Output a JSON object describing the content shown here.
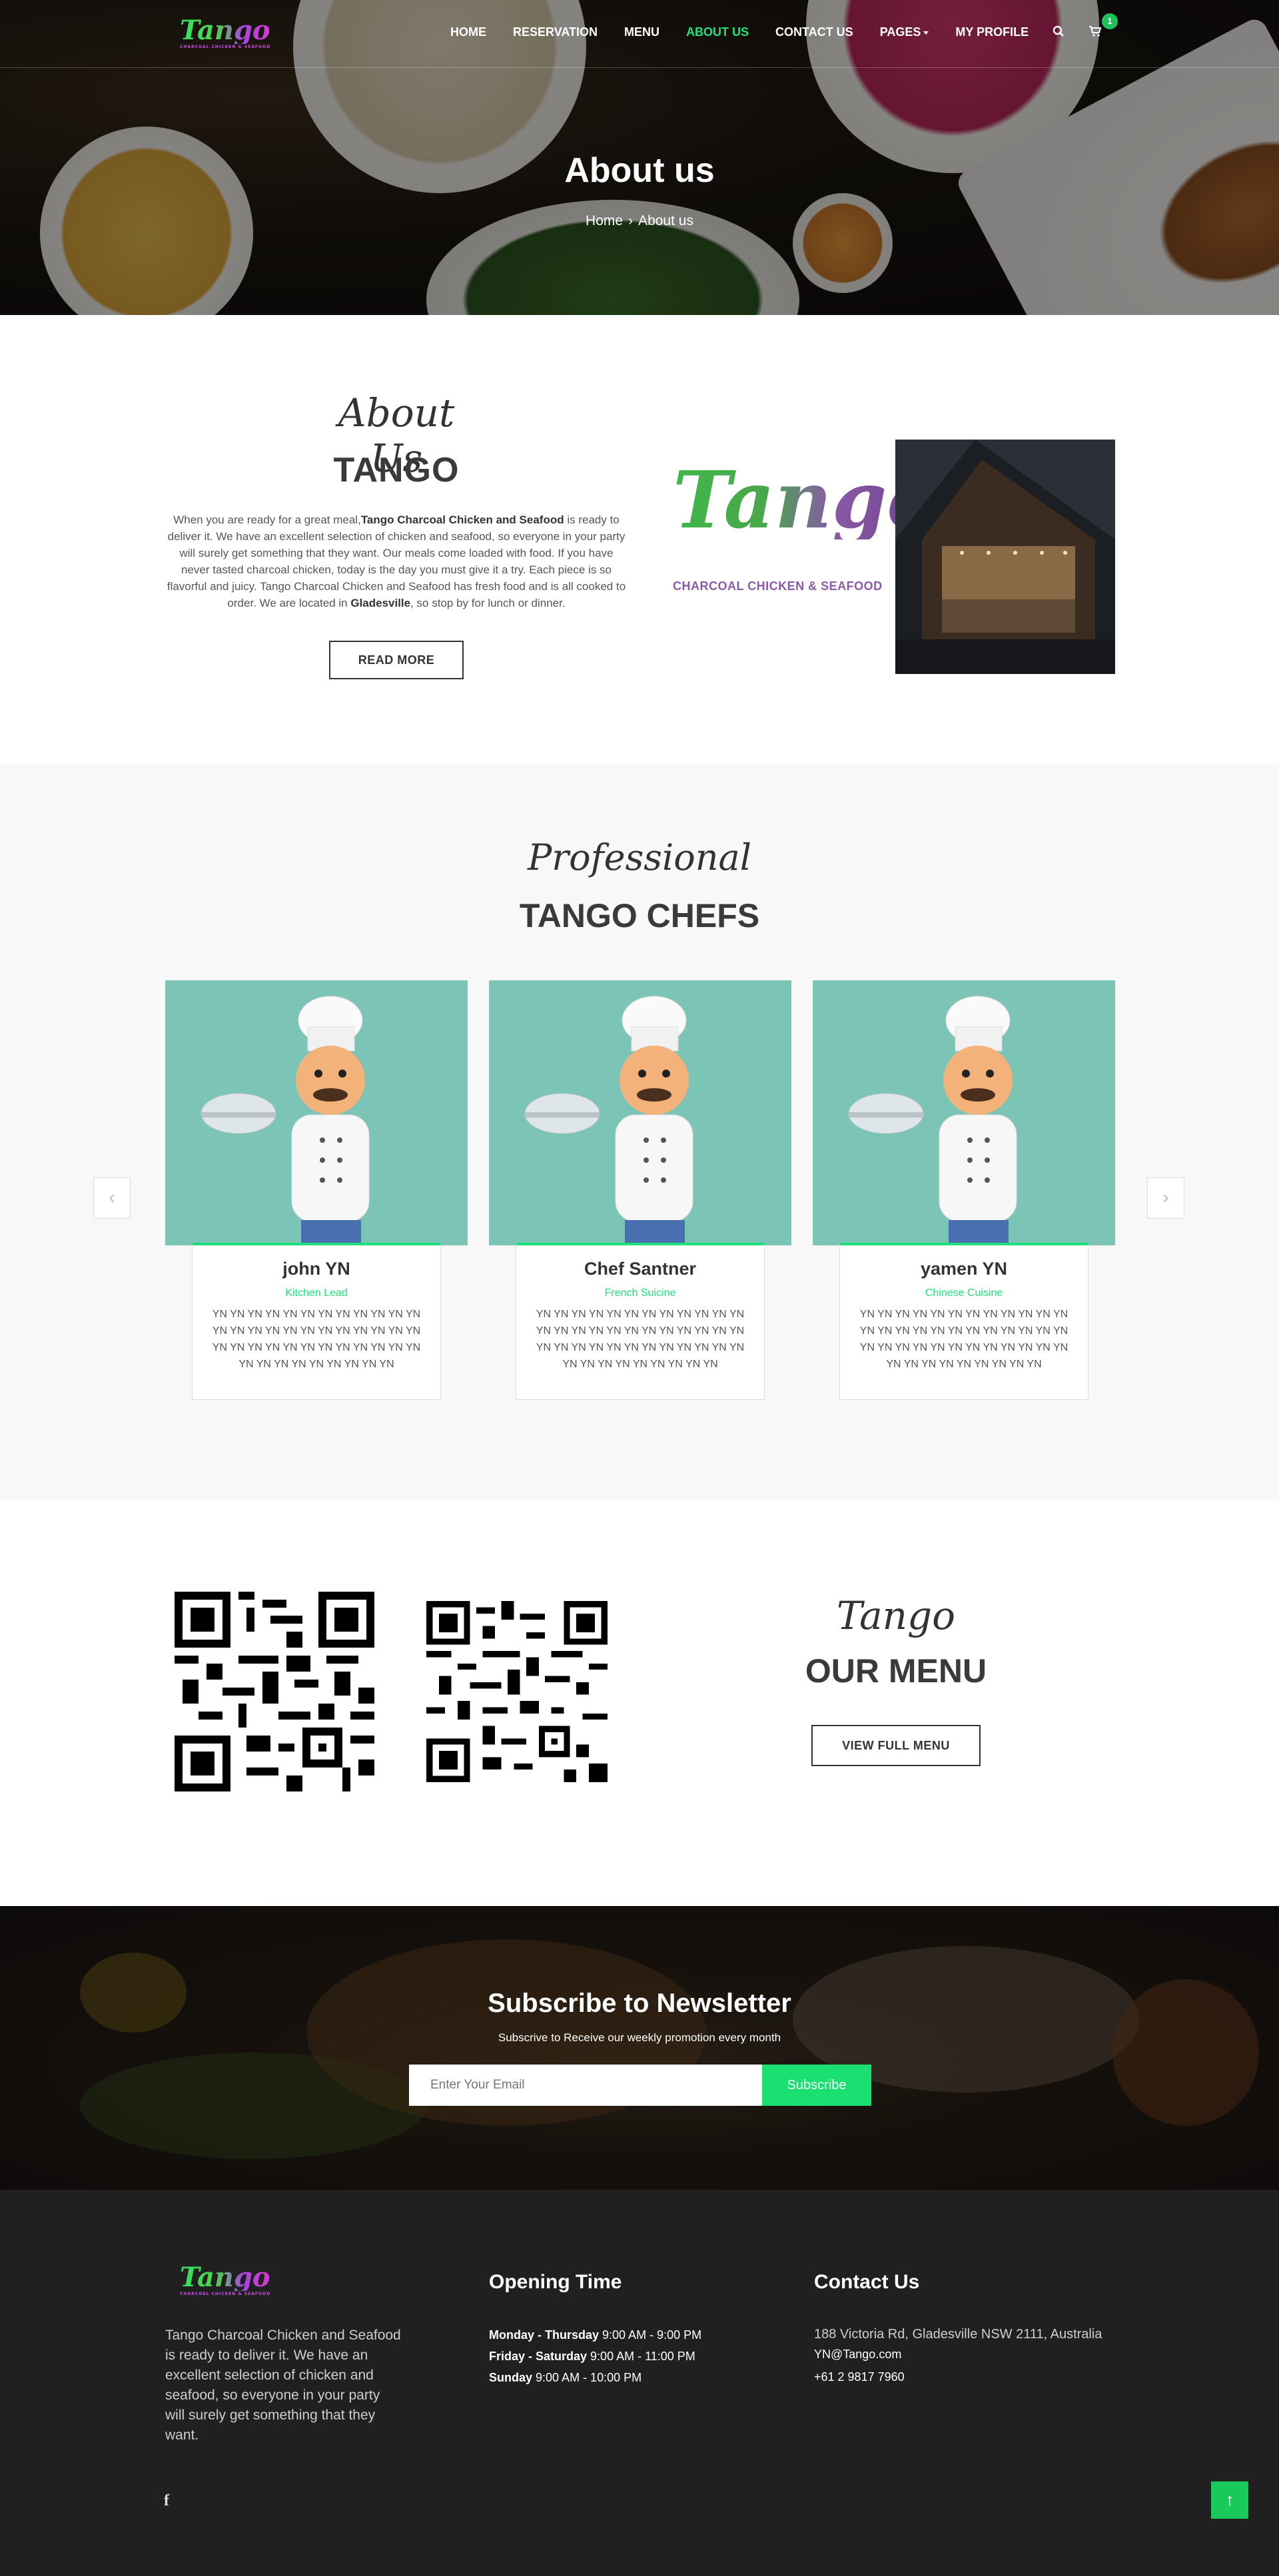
{
  "brand": {
    "logo_word": "Tango",
    "logo_sub": "CHARCOAL CHICKEN & SEAFOOD",
    "about_logo_sub": "CHARCOAL CHICKEN & SEAFOOD"
  },
  "nav": {
    "items": [
      {
        "label": "HOME",
        "active": false
      },
      {
        "label": "RESERVATION",
        "active": false
      },
      {
        "label": "MENU",
        "active": false
      },
      {
        "label": "ABOUT US",
        "active": true
      },
      {
        "label": "CONTACT US",
        "active": false
      },
      {
        "label": "PAGES",
        "active": false
      },
      {
        "label": "MY PROFILE",
        "active": false
      }
    ],
    "search_icon": "search-icon",
    "cart_icon": "cart-icon",
    "cart_count": "1"
  },
  "hero": {
    "title": "About us",
    "breadcrumb": {
      "home": "Home",
      "separator": "›",
      "current": "About us"
    }
  },
  "about": {
    "script": "About Us",
    "title": "TANGO",
    "text_1": "When you are ready for a great meal,",
    "text_bold_1": "Tango Charcoal Chicken and Seafood",
    "text_2": " is ready to deliver it. We have an excellent selection of chicken and seafood, so everyone in your party will surely get something that they want. Our meals come loaded with food. If you have never tasted charcoal chicken, today is the day you must give it a try. Each piece is so flavorful and juicy. Tango Charcoal Chicken and Seafood has fresh food and is all cooked to order. We are located in ",
    "text_bold_2": "Gladesville",
    "text_3": ", so stop by for lunch or dinner.",
    "button": "READ MORE"
  },
  "chefs": {
    "script": "Professional",
    "title": "TANGO CHEFS",
    "prev_icon": "chevron-left-icon",
    "next_icon": "chevron-right-icon",
    "items": [
      {
        "name": "john YN",
        "role": "Kitchen Lead",
        "desc": "YN YN YN YN YN YN YN YN YN YN YN YN YN YN YN YN YN YN YN YN YN YN YN YN YN YN YN YN YN YN YN YN YN YN YN YN YN YN YN YN YN YN YN YN YN"
      },
      {
        "name": "Chef Santner",
        "role": "French Suicine",
        "desc": "YN YN YN YN YN YN YN YN YN YN YN YN YN YN YN YN YN YN YN YN YN YN YN YN YN YN YN YN YN YN YN YN YN YN YN YN YN YN YN YN YN YN YN YN YN"
      },
      {
        "name": "yamen YN",
        "role": "Chinese Cuisine",
        "desc": "YN YN YN YN YN YN YN YN YN YN YN YN YN YN YN YN YN YN YN YN YN YN YN YN YN YN YN YN YN YN YN YN YN YN YN YN YN YN YN YN YN YN YN YN YN"
      }
    ]
  },
  "menu": {
    "script": "Tango",
    "title": "OUR MENU",
    "button": "VIEW FULL MENU"
  },
  "newsletter": {
    "title": "Subscribe to Newsletter",
    "subtitle": "Subscrive to Receive our weekly promotion every month",
    "placeholder": "Enter Your Email",
    "button": "Subscribe"
  },
  "footer": {
    "about": "Tango Charcoal Chicken and Seafood is ready to deliver it. We have an excellent selection of chicken and seafood, so everyone in your party will surely get something that they want.",
    "social_icon": "facebook-icon",
    "hours_title": "Opening Time",
    "hours": [
      {
        "days": "Monday - Thursday",
        "time": " 9:00 AM - 9:00 PM"
      },
      {
        "days": "Friday - Saturday",
        "time": "  9:00 AM - 11:00 PM"
      },
      {
        "days": "Sunday",
        "time": " 9:00 AM - 10:00 PM"
      }
    ],
    "contact_title": "Contact Us",
    "address": "188 Victoria Rd, Gladesville NSW 2111, Australia",
    "email": "YN@Tango.com",
    "phone": "+61 2 9817 7960",
    "to_top_icon": "arrow-up-icon"
  },
  "colors": {
    "accent": "#22e07a",
    "dark": "#202020",
    "chef_bg": "#7cc4b6"
  }
}
